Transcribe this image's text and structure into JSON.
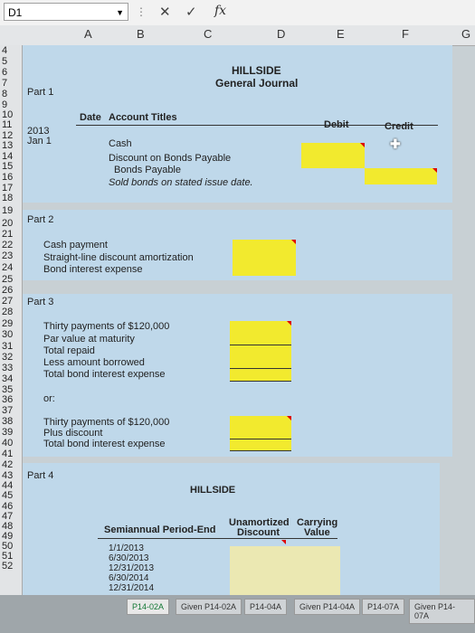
{
  "formula_bar": {
    "cell_ref": "D1",
    "fx_label": "fx"
  },
  "columns": [
    "A",
    "B",
    "C",
    "D",
    "E",
    "F",
    "G"
  ],
  "rows": [
    "4",
    "5",
    "6",
    "7",
    "8",
    "9",
    "10",
    "11",
    "12",
    "13",
    "14",
    "15",
    "16",
    "17",
    "18",
    "19",
    "20",
    "21",
    "22",
    "23",
    "24",
    "25",
    "26",
    "27",
    "28",
    "29",
    "30",
    "31",
    "32",
    "33",
    "34",
    "35",
    "36",
    "37",
    "38",
    "39",
    "40",
    "41",
    "42",
    "43",
    "44",
    "45",
    "46",
    "47",
    "48",
    "49",
    "50",
    "51",
    "52"
  ],
  "journal": {
    "title": "HILLSIDE",
    "subtitle": "General Journal",
    "part": "Part 1",
    "date_header": "Date",
    "account_header": "Account Titles",
    "debit_header": "Debit",
    "credit_header": "Credit",
    "year": "2013",
    "date": "Jan 1",
    "line1": "Cash",
    "line2": "Discount on Bonds Payable",
    "line3": "Bonds Payable",
    "memo": "Sold bonds on stated issue date."
  },
  "part2": {
    "label": "Part 2",
    "line1": "Cash payment",
    "line2": "Straight-line discount amortization",
    "line3": "Bond interest expense"
  },
  "part3": {
    "label": "Part 3",
    "line1": "Thirty payments of $120,000",
    "line2": "Par value at maturity",
    "line3": "Total repaid",
    "line4": "Less amount borrowed",
    "line5": "Total bond interest expense",
    "or": "or:",
    "line6": "Thirty payments of $120,000",
    "line7": "Plus discount",
    "line8": "Total bond interest expense"
  },
  "part4": {
    "label": "Part 4",
    "title": "HILLSIDE",
    "col1": "Semiannual Period-End",
    "col2a": "Unamortized",
    "col2b": "Discount",
    "col3a": "Carrying",
    "col3b": "Value",
    "dates": [
      "1/1/2013",
      "6/30/2013",
      "12/31/2013",
      "6/30/2014",
      "12/31/2014"
    ]
  },
  "sheet_tabs": [
    "P14-02A",
    "Given P14-02A",
    "P14-04A",
    "Given P14-04A",
    "P14-07A",
    "Given P14-07A"
  ]
}
